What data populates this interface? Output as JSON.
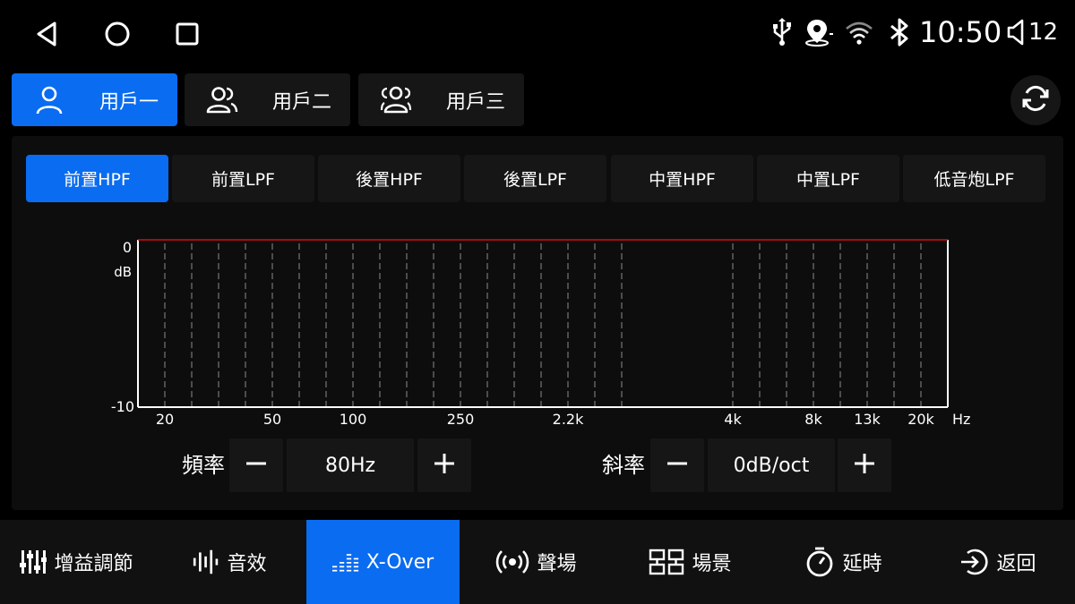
{
  "status": {
    "time": "10:50",
    "volume": "12",
    "icons": [
      "usb-icon",
      "location-icon",
      "wifi-icon",
      "bluetooth-icon",
      "volume-icon"
    ]
  },
  "nav_icons": [
    "back-icon",
    "home-icon",
    "recents-icon"
  ],
  "users": [
    {
      "label": "用戶一",
      "active": true
    },
    {
      "label": "用戶二",
      "active": false
    },
    {
      "label": "用戶三",
      "active": false
    }
  ],
  "filter_tabs": [
    {
      "label": "前置HPF",
      "active": true
    },
    {
      "label": "前置LPF",
      "active": false
    },
    {
      "label": "後置HPF",
      "active": false
    },
    {
      "label": "後置LPF",
      "active": false
    },
    {
      "label": "中置HPF",
      "active": false
    },
    {
      "label": "中置LPF",
      "active": false
    },
    {
      "label": "低音炮LPF",
      "active": false
    }
  ],
  "chart_data": {
    "type": "line",
    "y_top_label": "0",
    "y_unit": "dB",
    "y_bottom_label": "-10",
    "ylim": [
      -10,
      0
    ],
    "x_unit": "Hz",
    "x_tick_labels": [
      "20",
      "50",
      "100",
      "250",
      "2.2k",
      "4k",
      "8k",
      "13k",
      "20k"
    ],
    "grid": "vertical dashed",
    "series": [
      {
        "x": [
          20,
          20000
        ],
        "values": [
          0,
          0
        ],
        "color": "#d01010"
      }
    ]
  },
  "controls": {
    "frequency": {
      "label": "頻率",
      "value": "80Hz",
      "minus": "−",
      "plus": "+"
    },
    "slope": {
      "label": "斜率",
      "value": "0dB/oct",
      "minus": "−",
      "plus": "+"
    }
  },
  "bottom_nav": [
    {
      "label": "增益調節",
      "icon": "sliders-icon",
      "active": false
    },
    {
      "label": "音效",
      "icon": "waveform-icon",
      "active": false
    },
    {
      "label": "X-Over",
      "icon": "crossover-bars-icon",
      "active": true
    },
    {
      "label": "聲場",
      "icon": "soundfield-icon",
      "active": false
    },
    {
      "label": "場景",
      "icon": "scene-icon",
      "active": false
    },
    {
      "label": "延時",
      "icon": "timer-icon",
      "active": false
    },
    {
      "label": "返回",
      "icon": "return-icon",
      "active": false
    }
  ],
  "colors": {
    "accent": "#0a6cf0",
    "curve": "#d01010"
  }
}
